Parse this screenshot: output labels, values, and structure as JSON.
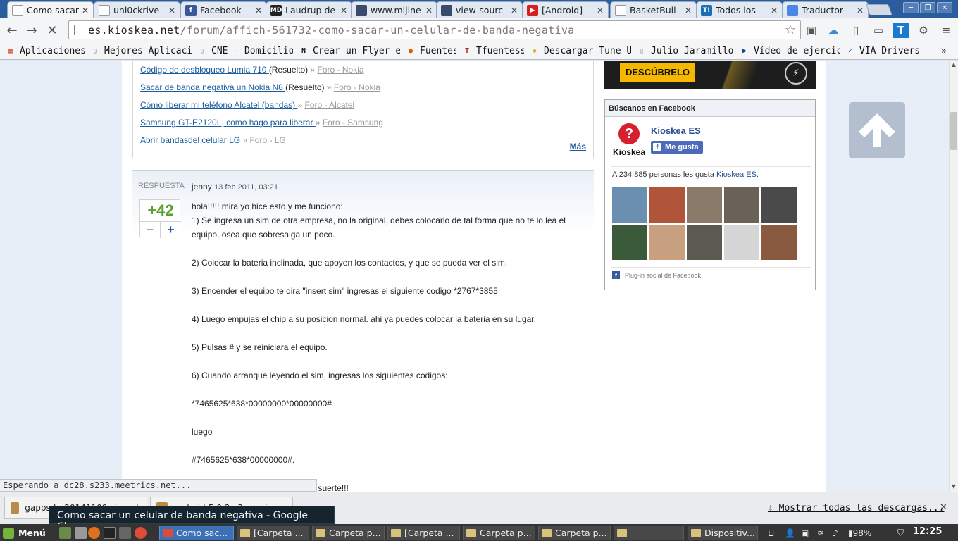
{
  "browser": {
    "tabs": [
      {
        "title": "Como sacar",
        "fav_color": "#ffffff",
        "fav_glyph": "",
        "active": true
      },
      {
        "title": "unl0ckrive",
        "fav_color": "#ffffff",
        "fav_glyph": "",
        "active": false
      },
      {
        "title": "Facebook",
        "fav_color": "#3b5998",
        "fav_glyph": "f",
        "active": false
      },
      {
        "title": "Laudrup de",
        "fav_color": "#222222",
        "fav_glyph": "MD",
        "active": false
      },
      {
        "title": "www.mijine",
        "fav_color": "#3a4a6a",
        "fav_glyph": "",
        "active": false
      },
      {
        "title": "view-sourc",
        "fav_color": "#3a4a6a",
        "fav_glyph": "",
        "active": false
      },
      {
        "title": "[Android]",
        "fav_color": "#d62020",
        "fav_glyph": "▶",
        "active": false
      },
      {
        "title": "BasketBuil",
        "fav_color": "#ffffff",
        "fav_glyph": "",
        "active": false
      },
      {
        "title": "Todos los",
        "fav_color": "#1a6fb5",
        "fav_glyph": "T!",
        "active": false
      },
      {
        "title": "Traductor",
        "fav_color": "#4a86e8",
        "fav_glyph": "",
        "active": false
      }
    ],
    "url_domain": "es.kioskea.net",
    "url_path": "/forum/affich-561732-como-sacar-un-celular-de-banda-negativa",
    "bookmarks": [
      {
        "label": "Aplicaciones",
        "icon": "apps-grid-icon",
        "color": "#d9472b"
      },
      {
        "label": "Mejores Aplicaciones",
        "icon": "page-icon",
        "color": "#888888"
      },
      {
        "label": "CNE - Domicilio Electoral",
        "icon": "page-icon",
        "color": "#888888"
      },
      {
        "label": "Crear un Flyer en",
        "icon": "n-icon",
        "color": "#111111"
      },
      {
        "label": "Fuentes",
        "icon": "fuentes-icon",
        "color": "#e05a00"
      },
      {
        "label": "Tfuentess",
        "icon": "t-icon",
        "color": "#c0141e"
      },
      {
        "label": "Descargar Tune Up",
        "icon": "diamond-icon",
        "color": "#e8a020"
      },
      {
        "label": "Julio Jaramillo -",
        "icon": "page-icon",
        "color": "#888888"
      },
      {
        "label": "Vídeo de ejercicios",
        "icon": "play-icon",
        "color": "#1a3a8a"
      },
      {
        "label": "VIA Drivers",
        "icon": "check-shield-icon",
        "color": "#1a5fb5"
      }
    ]
  },
  "related": [
    {
      "link": "Código de desbloqueo Lumia 710 ",
      "status": "(Resuelto)",
      "forum": "Foro - Nokia"
    },
    {
      "link": "Sacar de banda negativa un Nokia N8 ",
      "status": "(Resuelto)",
      "forum": "Foro - Nokia"
    },
    {
      "link": "Cómo liberar mi teléfono Alcatel (bandas) ",
      "status": "",
      "forum": "Foro - Alcatel"
    },
    {
      "link": "Samsung GT-E2120L, como hago para liberar ",
      "status": "",
      "forum": "Foro - Samsung"
    },
    {
      "link": "Abrir bandasdel celular LG ",
      "status": "",
      "forum": "Foro - LG"
    }
  ],
  "related_more": "Más",
  "answer": {
    "label": "RESPUESTA",
    "score": "+42",
    "minus": "−",
    "plus": "+",
    "author": "jenny",
    "date": "13 feb 2011, 03:21",
    "lines": [
      "hola!!!!! mira yo hice esto y me funciono:",
      "1) Se ingresa un sim de otra empresa, no la original, debes colocarlo de tal forma que no te lo lea el equipo, osea que sobresalga un poco.",
      "",
      "2) Colocar la bateria inclinada, que apoyen los contactos, y que se pueda ver el sim.",
      "",
      "3) Encender el equipo te dira \"insert sim\" ingresas el siguiente codigo *2767*3855",
      "",
      "4) Luego empujas el chip a su posicion normal. ahi ya puedes colocar la bateria en su lugar.",
      "",
      "5) Pulsas # y se reiniciara el equipo.",
      "",
      "6) Cuando arranque leyendo el sim, ingresas los siguientes codigos:",
      "",
      "*7465625*638*00000000*00000000#",
      "",
      "luego",
      "",
      "#7465625*638*00000000#.",
      "",
      "berado. espero que te funcione!!! suerte!!!"
    ]
  },
  "ad": {
    "cta": "DESCÚBRELO"
  },
  "facebook": {
    "header": "Búscanos en Facebook",
    "logo_text": "Kioskea",
    "page_name": "Kioskea ES",
    "like": "Me gusta",
    "count_prefix": "A 234 885 personas les gusta ",
    "count_link": "Kioskea ES",
    "count_suffix": ".",
    "plugin": "Plug-in social de Facebook",
    "faces": [
      "#6a8fb0",
      "#b0543a",
      "#8a7a6a",
      "#6a6258",
      "#4a4a4a",
      "#3a5a3a",
      "#c8a080",
      "#5a5a50",
      "#d6d6d6",
      "#8a5a40"
    ]
  },
  "status_text": "Esperando a dc28.s233.meetrics.net...",
  "downloads": [
    {
      "name": "gapps-lp-20141109-signed..."
    },
    {
      "name": "android-5.0.2_r3-omni-..."
    }
  ],
  "show_all": "Mostrar todas las descargas...",
  "tooltip": "Como sacar un celular de banda negativa - Google Chrome",
  "taskbar": {
    "menu": "Menú",
    "tasks": [
      {
        "label": "Como sac...",
        "active": true
      },
      {
        "label": "[Carpeta ...",
        "active": false
      },
      {
        "label": "Carpeta p...",
        "active": false
      },
      {
        "label": "[Carpeta ...",
        "active": false
      },
      {
        "label": "Carpeta p...",
        "active": false
      },
      {
        "label": "Carpeta p...",
        "active": false
      },
      {
        "label": "",
        "active": false
      },
      {
        "label": "Dispositiv...",
        "active": false
      }
    ],
    "battery": "98%",
    "clock": "12:25"
  }
}
